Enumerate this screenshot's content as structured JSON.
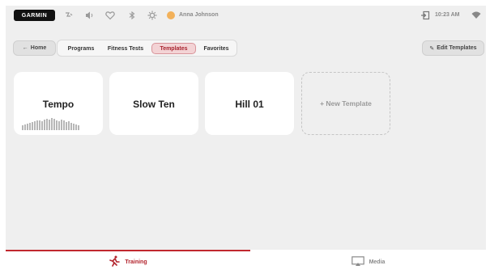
{
  "header": {
    "logo": "GARMIN",
    "status_icons": [
      "workout-icon",
      "volume-icon",
      "heart-rate-icon",
      "bluetooth-icon",
      "settings-icon"
    ],
    "user_name": "Anna Johnson",
    "time": "10:23 AM",
    "right_icons": [
      "exit-icon",
      "wifi-icon"
    ]
  },
  "nav": {
    "home_label": "Home",
    "tabs": [
      {
        "label": "Programs",
        "active": false
      },
      {
        "label": "Fitness Tests",
        "active": false
      },
      {
        "label": "Templates",
        "active": true
      },
      {
        "label": "Favorites",
        "active": false
      }
    ],
    "edit_label": "Edit Templates"
  },
  "templates": [
    {
      "name": "Tempo",
      "profile": [
        6,
        7,
        8,
        9,
        10,
        11,
        12,
        12,
        11,
        13,
        14,
        13,
        15,
        14,
        12,
        11,
        13,
        12,
        10,
        11,
        9,
        8,
        7,
        6
      ]
    },
    {
      "name": "Slow Ten"
    },
    {
      "name": "Hill 01"
    }
  ],
  "new_template_label": "+ New Template",
  "bottom_nav": [
    {
      "label": "Training",
      "icon": "running-icon",
      "active": true
    },
    {
      "label": "Media",
      "icon": "media-screen-icon",
      "active": false
    }
  ],
  "colors": {
    "accent": "#c1282f",
    "background": "#efefef",
    "card": "#ffffff"
  }
}
